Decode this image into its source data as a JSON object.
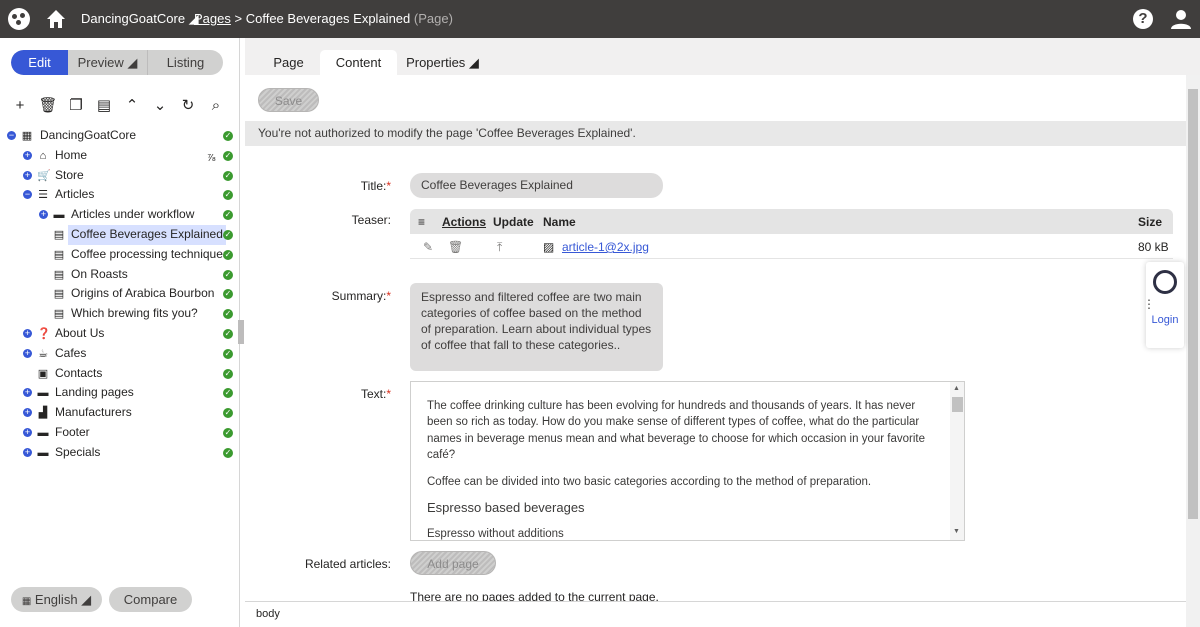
{
  "topbar": {
    "site_name": "DancingGoatCore",
    "breadcrumb_link": "Pages",
    "breadcrumb_sep": ">",
    "page_name": "Coffee Beverages Explained",
    "page_type": "(Page)"
  },
  "modes": {
    "edit": "Edit",
    "preview": "Preview",
    "listing": "Listing"
  },
  "tree": {
    "root": "DancingGoatCore",
    "items": [
      {
        "label": "Home"
      },
      {
        "label": "Store"
      },
      {
        "label": "Articles"
      },
      {
        "label": "Articles under workflow"
      },
      {
        "label": "Coffee Beverages Explained"
      },
      {
        "label": "Coffee processing techniques"
      },
      {
        "label": "On Roasts"
      },
      {
        "label": "Origins of Arabica Bourbon"
      },
      {
        "label": "Which brewing fits you?"
      },
      {
        "label": "About Us"
      },
      {
        "label": "Cafes"
      },
      {
        "label": "Contacts"
      },
      {
        "label": "Landing pages"
      },
      {
        "label": "Manufacturers"
      },
      {
        "label": "Footer"
      },
      {
        "label": "Specials"
      }
    ]
  },
  "footer_left": {
    "language": "English",
    "compare": "Compare"
  },
  "tabs": {
    "page": "Page",
    "content": "Content",
    "properties": "Properties"
  },
  "form": {
    "save_label": "Save",
    "warning": "You're not authorized to modify the page 'Coffee Beverages Explained'.",
    "title_label": "Title:",
    "title_value": "Coffee Beverages Explained",
    "teaser_label": "Teaser:",
    "teaser_grid": {
      "col_actions": "Actions",
      "col_update": "Update",
      "col_name": "Name",
      "col_size": "Size",
      "file_name": "article-1@2x.jpg",
      "file_size": "80 kB"
    },
    "summary_label": "Summary:",
    "summary_value": "Espresso and filtered coffee are two main categories of coffee based on the method of preparation. Learn about individual types of coffee that fall to these categories..",
    "text_label": "Text:",
    "text_p1": "The coffee drinking culture has been evolving for hundreds and thousands of years. It has never been so rich as today. How do you make sense of different types of coffee, what do the particular names in beverage menus mean and what beverage to choose for which occasion in your favorite café?",
    "text_p2": "Coffee can be divided into two basic categories according to the method of preparation.",
    "text_h": "Espresso based beverages",
    "text_p3": "Espresso without additions",
    "related_label": "Related articles:",
    "add_page": "Add page",
    "no_pages": "There are no pages added to the current page."
  },
  "statusbar": "body",
  "widget": {
    "login": "Login"
  }
}
